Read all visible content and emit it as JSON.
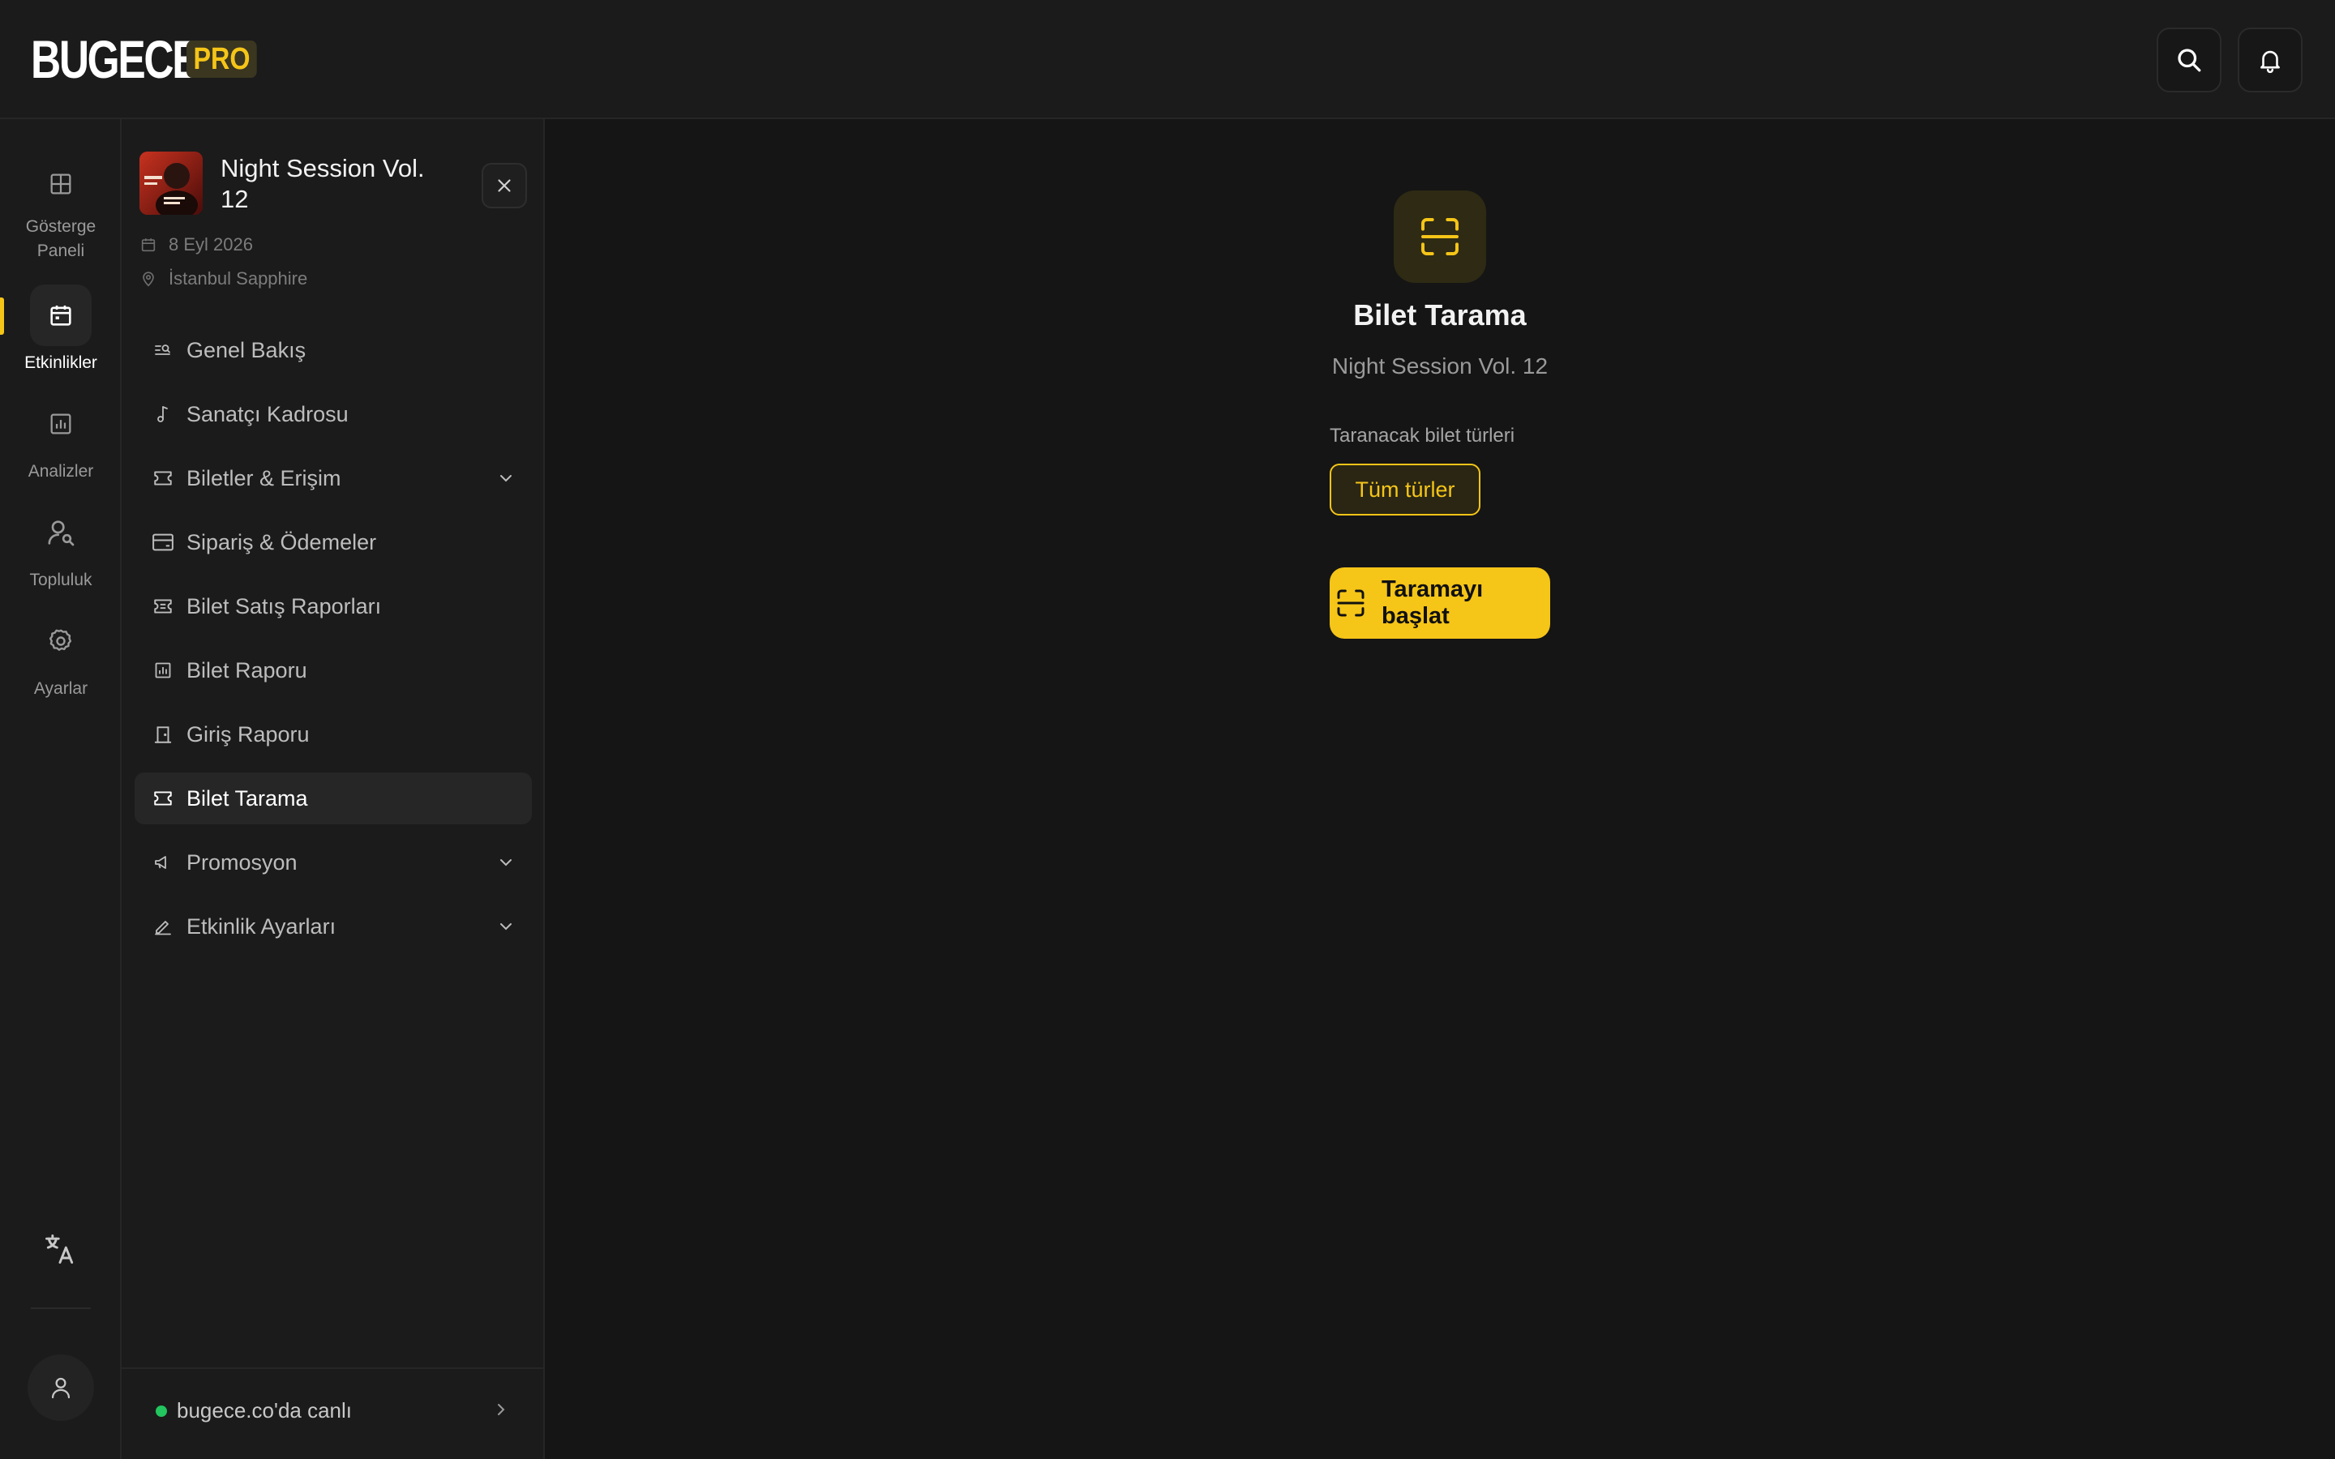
{
  "header": {
    "logo_text": "BUGECE",
    "logo_badge": "PRO",
    "search_icon": "search-icon",
    "bell_icon": "bell-icon"
  },
  "rail": {
    "items": [
      {
        "label": "Gösterge\nPaneli",
        "icon": "dashboard-icon",
        "active": false
      },
      {
        "label": "Etkinlikler",
        "icon": "calendar-icon",
        "active": true
      },
      {
        "label": "Analizler",
        "icon": "chart-icon",
        "active": false
      },
      {
        "label": "Topluluk",
        "icon": "user-search-icon",
        "active": false
      },
      {
        "label": "Ayarlar",
        "icon": "gear-icon",
        "active": false
      }
    ],
    "language_icon": "translate-icon",
    "profile_icon": "user-icon"
  },
  "event": {
    "title": "Night Session Vol. 12",
    "date": "8 Eyl 2026",
    "venue": "İstanbul Sapphire"
  },
  "nav": {
    "items": [
      {
        "label": "Genel Bakış",
        "icon": "overview-icon"
      },
      {
        "label": "Sanatçı Kadrosu",
        "icon": "music-note-icon"
      },
      {
        "label": "Biletler & Erişim",
        "icon": "ticket-icon",
        "expandable": true
      },
      {
        "label": "Sipariş & Ödemeler",
        "icon": "card-icon"
      },
      {
        "label": "Bilet Satış Raporları",
        "icon": "ticket-report-icon"
      },
      {
        "label": "Bilet Raporu",
        "icon": "bar-chart-icon"
      },
      {
        "label": "Giriş Raporu",
        "icon": "door-icon"
      },
      {
        "label": "Bilet Tarama",
        "icon": "ticket-icon",
        "active": true
      },
      {
        "label": "Promosyon",
        "icon": "megaphone-icon",
        "expandable": true
      },
      {
        "label": "Etkinlik Ayarları",
        "icon": "pencil-icon",
        "expandable": true
      }
    ],
    "live_label": "bugece.co'da canlı"
  },
  "main": {
    "title": "Bilet Tarama",
    "subtitle": "Night Session Vol. 12",
    "types_label": "Taranacak bilet türleri",
    "chip_label": "Tüm türler",
    "start_label": "Taramayı başlat"
  },
  "colors": {
    "accent": "#f5c518",
    "background": "#151515",
    "panel": "#1b1b1b",
    "live": "#22c55e"
  }
}
